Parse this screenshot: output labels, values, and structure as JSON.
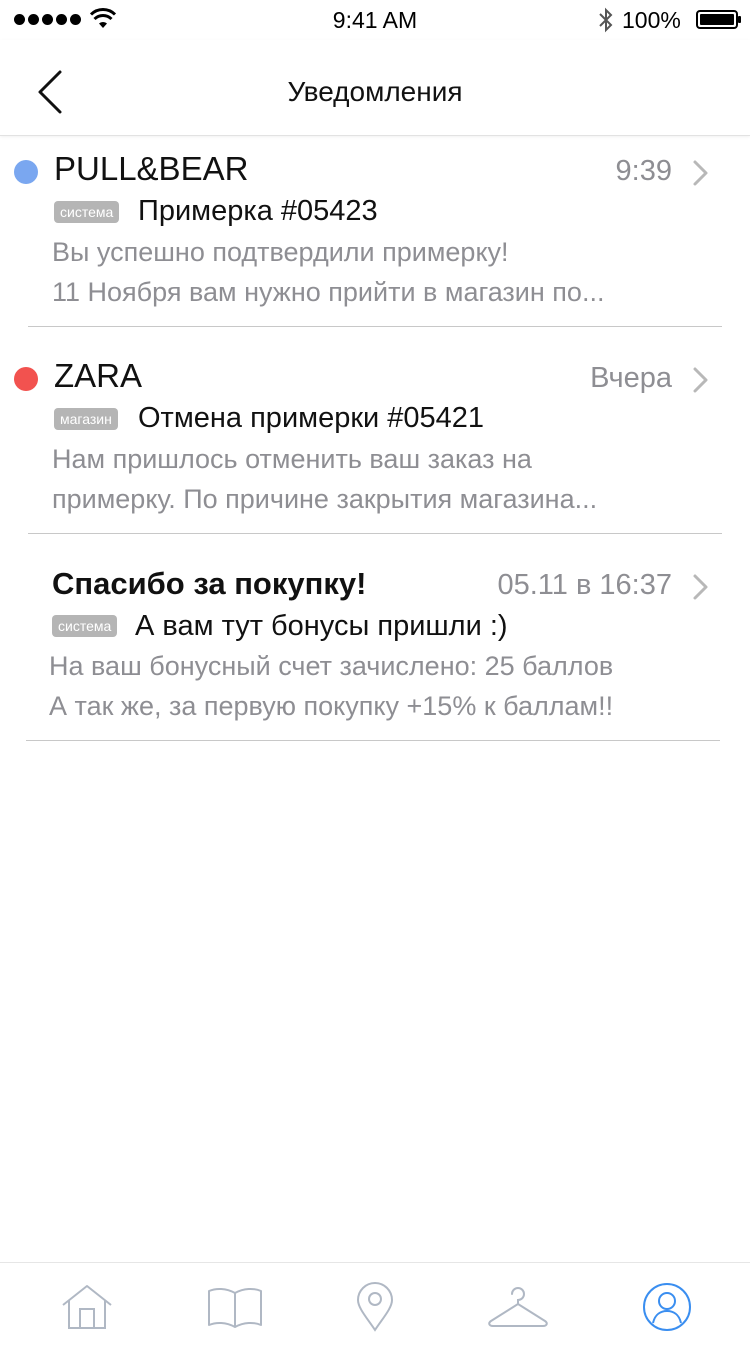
{
  "status_bar": {
    "time": "9:41 AM",
    "battery": "100%"
  },
  "header": {
    "title": "Уведомления"
  },
  "notifications": [
    {
      "sender": "PULL&BEAR",
      "unread_color": "#7aa7f0",
      "time": "9:39",
      "tag": "система",
      "subject": "Примерка #05423",
      "body_line1": "Вы успешно подтвердили примерку!",
      "body_line2": "11 Ноября вам нужно прийти в магазин по..."
    },
    {
      "sender": "ZARA",
      "unread_color": "#f2524f",
      "time": "Вчера",
      "tag": "магазин",
      "subject": "Отмена примерки #05421",
      "body_line1": "Нам пришлось отменить ваш заказ на",
      "body_line2": "примерку. По причине закрытия магазина..."
    },
    {
      "sender": "Спасибо за покупку!",
      "time": "05.11 в 16:37",
      "tag": "система",
      "subject": "А вам тут бонусы пришли :)",
      "body_line1": "На ваш бонусный счет зачислено: 25 баллов",
      "body_line2": "А так же, за первую покупку +15% к баллам!!"
    }
  ],
  "tab_bar": {
    "tabs": [
      "home-icon",
      "catalog-book-icon",
      "location-pin-icon",
      "hanger-icon",
      "profile-icon"
    ],
    "inactive_color": "#b0b8c4",
    "active_color": "#3a8ef0",
    "active_tab": "profile-icon"
  }
}
